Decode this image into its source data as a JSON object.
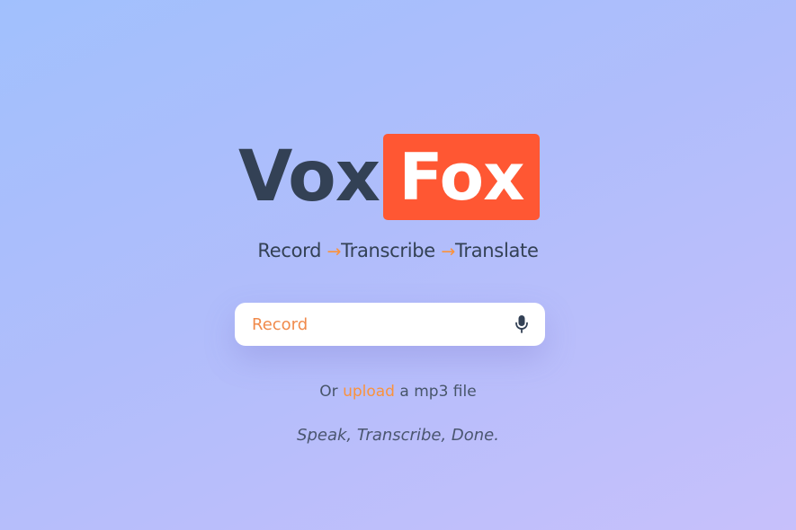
{
  "logo": {
    "part1": "Vox",
    "part2": "Fox"
  },
  "tagline": {
    "step1": "Record",
    "step2": "Transcribe",
    "step3": "Translate",
    "arrow": "→"
  },
  "record_button": {
    "label": "Record",
    "icon": "microphone-icon"
  },
  "upload": {
    "prefix": "Or",
    "link_text": "upload",
    "suffix": "a mp3 file"
  },
  "motto": "Speak, Transcribe, Done.",
  "colors": {
    "accent": "#ff5733",
    "orange_text": "#fb923c",
    "dark_text": "#334155",
    "card": "#ffffff"
  }
}
